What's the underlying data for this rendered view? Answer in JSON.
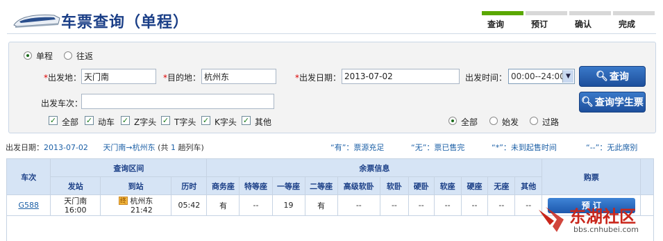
{
  "header": {
    "title": "车票查询（单程）",
    "steps": [
      {
        "label": "查询",
        "active": true
      },
      {
        "label": "预订",
        "active": false
      },
      {
        "label": "确认",
        "active": false
      },
      {
        "label": "完成",
        "active": false
      }
    ]
  },
  "form": {
    "trip_type": {
      "one_way": "单程",
      "round_trip": "往返",
      "selected": "单程"
    },
    "from_label": "出发地：",
    "from_value": "天门南",
    "to_label": "目的地：",
    "to_value": "杭州东",
    "date_label": "出发日期：",
    "date_value": "2013-07-02",
    "time_label": "出发时间：",
    "time_value": "00:00--24:00",
    "train_no_label": "出发车次：",
    "train_no_value": "",
    "query_button": "查询",
    "student_button": "查询学生票",
    "train_types": [
      {
        "label": "全部",
        "checked": true
      },
      {
        "label": "动车",
        "checked": true
      },
      {
        "label": "Z字头",
        "checked": true
      },
      {
        "label": "T字头",
        "checked": true
      },
      {
        "label": "K字头",
        "checked": true
      },
      {
        "label": "其他",
        "checked": true
      }
    ],
    "station_filter": {
      "all": "全部",
      "origin": "始发",
      "pass": "过路",
      "selected": "全部"
    }
  },
  "summary": {
    "date_label": "出发日期：",
    "date": "2013-07-02",
    "route": "天门南→杭州东",
    "count_prefix": "(共",
    "count": "1",
    "count_suffix": "趟列车)",
    "legend": [
      "“有”：票源充足",
      "“无”：票已售完",
      "“*”：未到起售时间",
      "“--”：无此席别"
    ]
  },
  "table": {
    "headers": {
      "train": "车次",
      "interval": "查询区间",
      "remaining": "余票信息",
      "booking": "购票",
      "depart": "发站",
      "arrive": "到站",
      "duration": "历时",
      "seats": [
        "商务座",
        "特等座",
        "一等座",
        "二等座",
        "高级软卧",
        "软卧",
        "硬卧",
        "软座",
        "硬座",
        "无座",
        "其他"
      ]
    },
    "rows": [
      {
        "train": "G588",
        "from_station": "天门南",
        "from_time": "16:00",
        "stop_badge": "终",
        "to_station": "杭州东",
        "to_time": "21:42",
        "duration": "05:42",
        "seats": [
          "有",
          "--",
          "19",
          "有",
          "--",
          "--",
          "--",
          "--",
          "--",
          "--",
          "--"
        ],
        "book_label": "预 订"
      }
    ]
  },
  "watermark": {
    "name": "东湖社区",
    "url": "bbs.cnhubei.com"
  },
  "colors": {
    "title": "#1b3f87",
    "active_step": "#5aa800",
    "button": "#1d4f9c",
    "available": "#1a8a1a",
    "watermark": "#c9261b"
  }
}
